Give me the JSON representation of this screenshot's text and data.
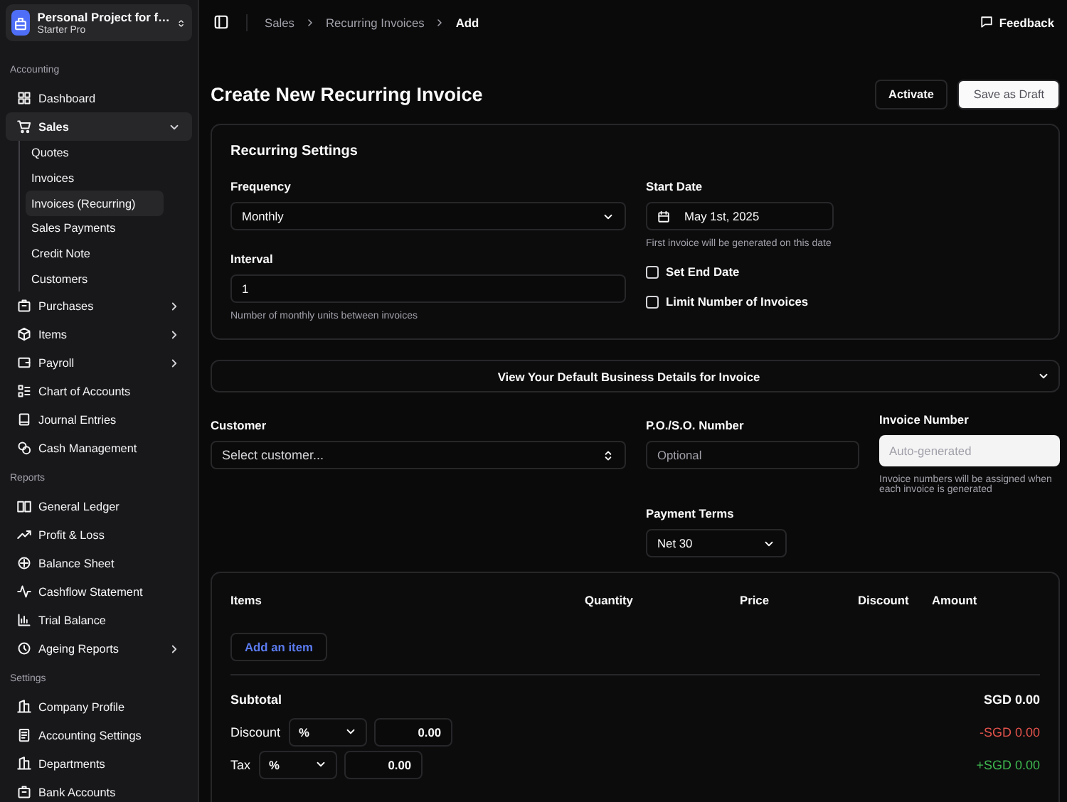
{
  "workspace": {
    "name": "Personal Project for f…",
    "plan": "Starter Pro"
  },
  "sidebar": {
    "sections": [
      {
        "label": "Accounting",
        "items": [
          {
            "label": "Dashboard",
            "selected": false
          },
          {
            "label": "Sales",
            "selected": true,
            "expanded": true,
            "children": [
              {
                "label": "Quotes",
                "selected": false
              },
              {
                "label": "Invoices",
                "selected": false
              },
              {
                "label": "Invoices (Recurring)",
                "selected": true
              },
              {
                "label": "Sales Payments",
                "selected": false
              },
              {
                "label": "Credit Note",
                "selected": false
              },
              {
                "label": "Customers",
                "selected": false
              }
            ]
          },
          {
            "label": "Purchases",
            "selected": false,
            "expanded": false
          },
          {
            "label": "Items",
            "selected": false,
            "expanded": false
          },
          {
            "label": "Payroll",
            "selected": false,
            "expanded": false
          },
          {
            "label": "Chart of Accounts",
            "selected": false
          },
          {
            "label": "Journal Entries",
            "selected": false
          },
          {
            "label": "Cash Management",
            "selected": false
          }
        ]
      },
      {
        "label": "Reports",
        "items": [
          {
            "label": "General Ledger",
            "selected": false
          },
          {
            "label": "Profit & Loss",
            "selected": false
          },
          {
            "label": "Balance Sheet",
            "selected": false
          },
          {
            "label": "Cashflow Statement",
            "selected": false
          },
          {
            "label": "Trial Balance",
            "selected": false
          },
          {
            "label": "Ageing Reports",
            "selected": false,
            "expanded": false
          }
        ]
      },
      {
        "label": "Settings",
        "items": [
          {
            "label": "Company Profile",
            "selected": false
          },
          {
            "label": "Accounting Settings",
            "selected": false
          },
          {
            "label": "Departments",
            "selected": false
          },
          {
            "label": "Bank Accounts",
            "selected": false
          }
        ]
      }
    ]
  },
  "breadcrumb": [
    {
      "label": "Sales",
      "selected": false
    },
    {
      "label": "Recurring Invoices",
      "selected": false
    },
    {
      "label": "Add",
      "selected": true
    }
  ],
  "feedback": "Feedback",
  "page_title": "Create New Recurring Invoice",
  "actions": [
    {
      "label": "Activate",
      "kind": "secondary"
    },
    {
      "label": "Save as Draft",
      "kind": "primary"
    }
  ],
  "recurring_settings": {
    "title": "Recurring Settings",
    "frequency": {
      "label": "Frequency",
      "value": "Monthly"
    },
    "interval": {
      "label": "Interval",
      "value": "1",
      "hint": "Number of monthly units between invoices"
    },
    "start_date": {
      "label": "Start Date",
      "value": "May 1st, 2025",
      "hint": "First invoice will be generated on this date"
    },
    "options": [
      {
        "label": "Set End Date",
        "checked": false
      },
      {
        "label": "Limit Number of Invoices",
        "checked": false
      }
    ]
  },
  "business_details": {
    "label": "View Your Default Business Details for Invoice",
    "expanded": false
  },
  "customer": {
    "label": "Customer",
    "placeholder": "Select customer..."
  },
  "po_number": {
    "label": "P.O./S.O. Number",
    "placeholder": "Optional"
  },
  "invoice_number": {
    "label": "Invoice Number",
    "placeholder": "Auto-generated",
    "hint": "Invoice numbers will be assigned when each invoice is generated"
  },
  "payment_terms": {
    "label": "Payment Terms",
    "value": "Net 30"
  },
  "items_table": {
    "columns": [
      "Items",
      "Quantity",
      "Price",
      "Discount",
      "Amount"
    ],
    "add_button": "Add an item"
  },
  "totals": [
    {
      "kind": "plain",
      "label": "Subtotal",
      "amount": "SGD 0.00"
    },
    {
      "kind": "adjust",
      "label": "Discount",
      "type": "%",
      "value": "0.00",
      "amount": "-SGD 0.00",
      "color": "#e5534b"
    },
    {
      "kind": "adjust",
      "label": "Tax",
      "type": "%",
      "value": "0.00",
      "amount": "+SGD 0.00",
      "color": "#3fb950"
    }
  ]
}
